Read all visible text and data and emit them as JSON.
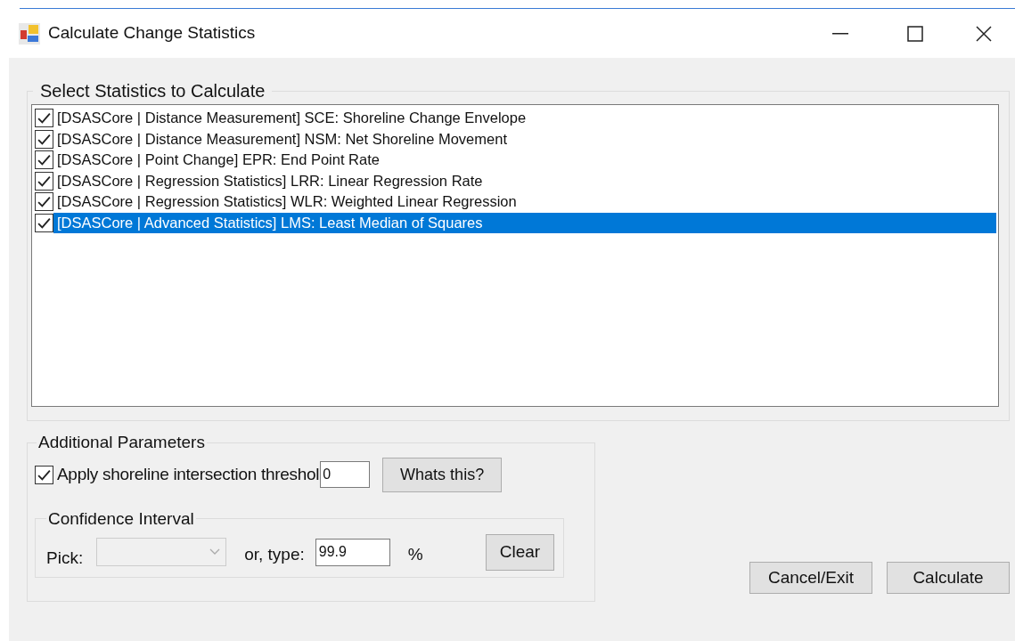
{
  "window": {
    "title": "Calculate Change Statistics"
  },
  "statistics": {
    "title": "Select Statistics to Calculate",
    "items": [
      {
        "label": "[DSASCore | Distance Measurement] SCE: Shoreline Change Envelope",
        "checked": true,
        "selected": false
      },
      {
        "label": "[DSASCore | Distance Measurement] NSM: Net Shoreline Movement",
        "checked": true,
        "selected": false
      },
      {
        "label": "[DSASCore | Point Change] EPR: End Point Rate",
        "checked": true,
        "selected": false
      },
      {
        "label": "[DSASCore | Regression Statistics] LRR: Linear Regression Rate",
        "checked": true,
        "selected": false
      },
      {
        "label": "[DSASCore | Regression Statistics] WLR: Weighted Linear Regression",
        "checked": true,
        "selected": false
      },
      {
        "label": "[DSASCore | Advanced Statistics] LMS: Least Median of Squares",
        "checked": true,
        "selected": true
      }
    ]
  },
  "additional_parameters": {
    "title": "Additional Parameters",
    "threshold": {
      "label": "Apply shoreline intersection threshol",
      "checked": true,
      "value": "0"
    },
    "help_button": "Whats this?",
    "confidence_interval": {
      "title": "Confidence Interval",
      "pick_label": "Pick:",
      "pick_disabled": true,
      "type_label": "or, type:",
      "value": "99.9",
      "unit": "%",
      "clear_button": "Clear"
    }
  },
  "buttons": [
    "Cancel/Exit",
    "Calculate"
  ]
}
